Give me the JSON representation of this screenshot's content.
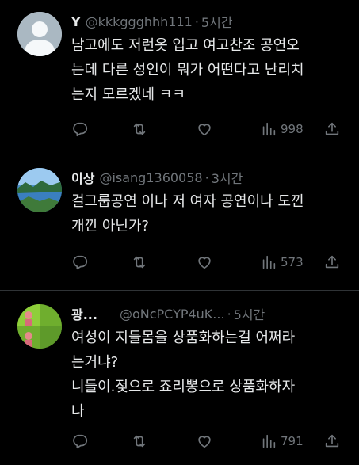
{
  "tweets": [
    {
      "name": "Y",
      "handle": "@kkkggghhh111",
      "separator": "·",
      "time": "5시간",
      "text": "남고에도 저런옷 입고 여고찬조 공연오\n는데 다른 성인이 뭐가 어떤다고 난리치\n는지 모르겠네 ㅋㅋ",
      "views": "998"
    },
    {
      "name": "이상",
      "handle": "@isang1360058",
      "separator": "·",
      "time": "3시간",
      "text": "걸그룹공연 이나 저 여자 공연이나 도낀\n개낀 아닌가?",
      "views": "573"
    },
    {
      "name": "광...",
      "handle": "@oNcPCYP4uK...",
      "separator": "·",
      "time": "5시간",
      "text": "여성이 지들몸을 상품화하는걸 어쩌라\n는거냐?\n니들이.젖으로 죠리뽕으로 상품화하자\n나",
      "views": "791"
    }
  ],
  "icons": [
    "reply-icon",
    "retweet-icon",
    "like-icon",
    "views-icon",
    "share-icon"
  ],
  "colors": {
    "background": "#000000",
    "text": "#e7e9ea",
    "muted": "#71767b",
    "divider": "#2f3336"
  }
}
